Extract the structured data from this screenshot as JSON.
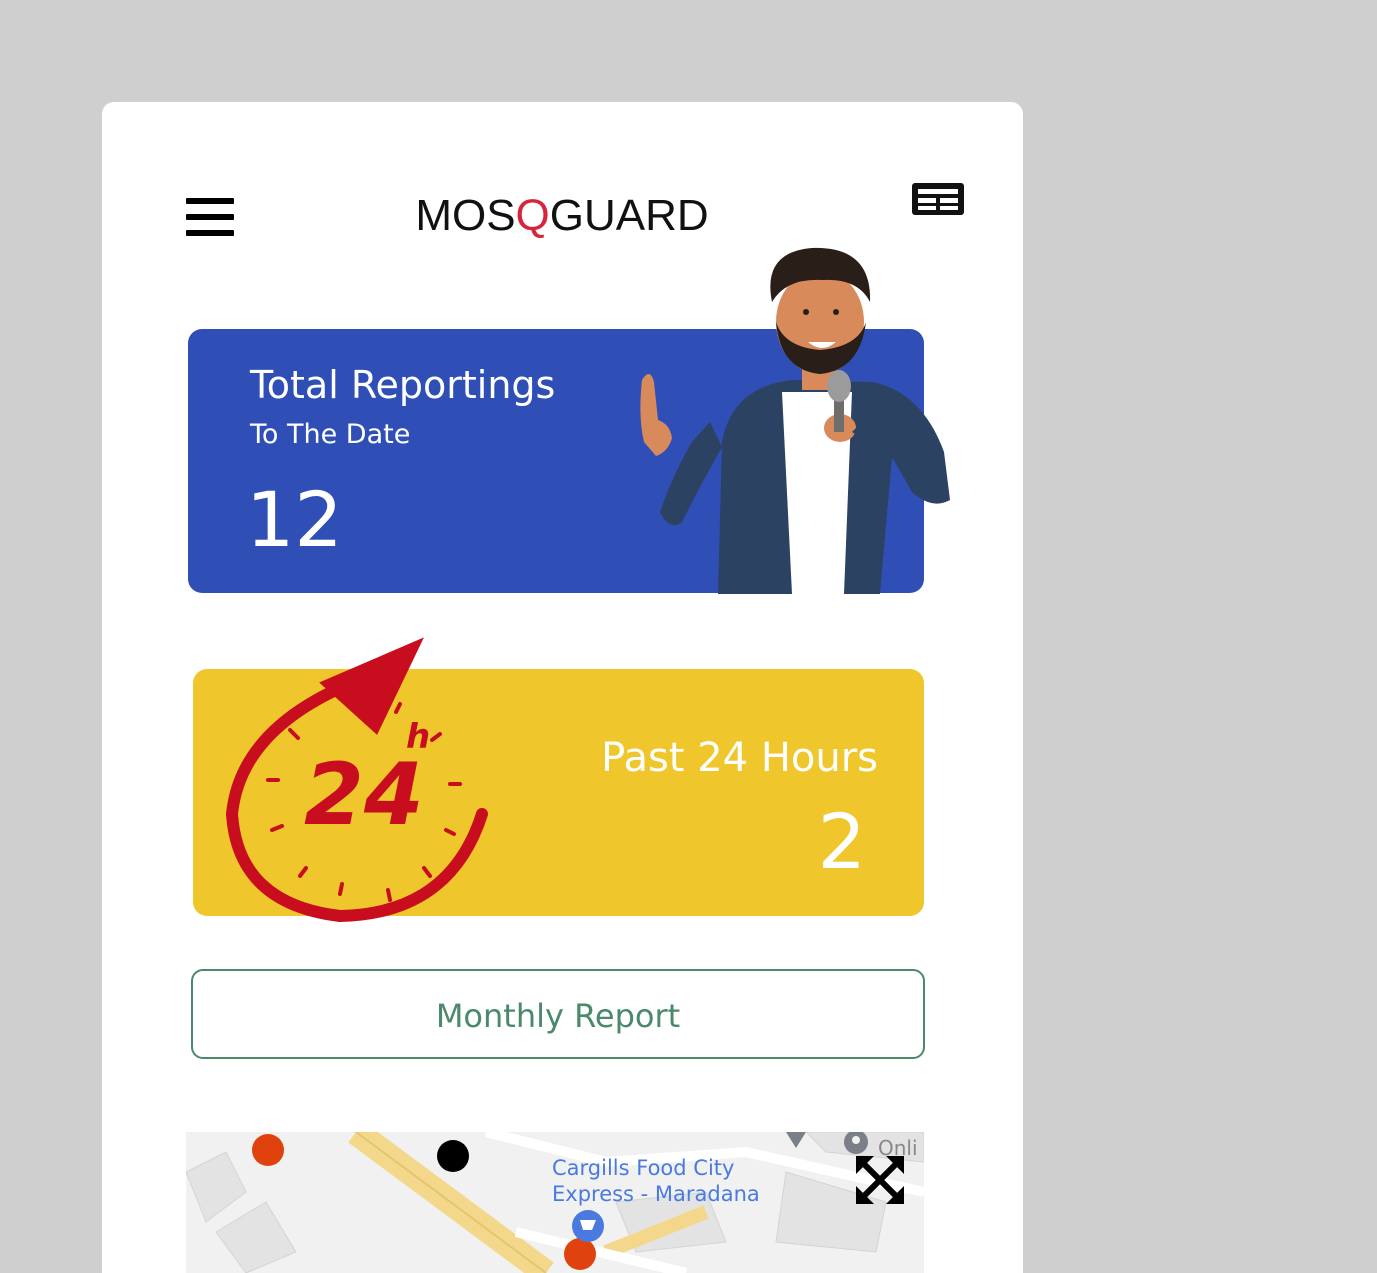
{
  "header": {
    "logo": {
      "part1": "MOS",
      "part2": "Q",
      "part3": "GUARD"
    },
    "menu_icon": "hamburger-icon",
    "news_icon": "newspaper-icon"
  },
  "total_card": {
    "title": "Total Reportings",
    "subtitle": "To The Date",
    "value": "12",
    "color": "#2f4fb6"
  },
  "past24_card": {
    "badge_text": "24",
    "badge_suffix": "h",
    "label": "Past 24 Hours",
    "value": "2",
    "color": "#efc72c"
  },
  "monthly_button": {
    "label": "Monthly Report"
  },
  "map": {
    "place_line1": "Cargills Food City",
    "place_line2": "Express - Maradana",
    "partial_label": "Onli",
    "expand_icon": "fullscreen-expand-icon"
  }
}
